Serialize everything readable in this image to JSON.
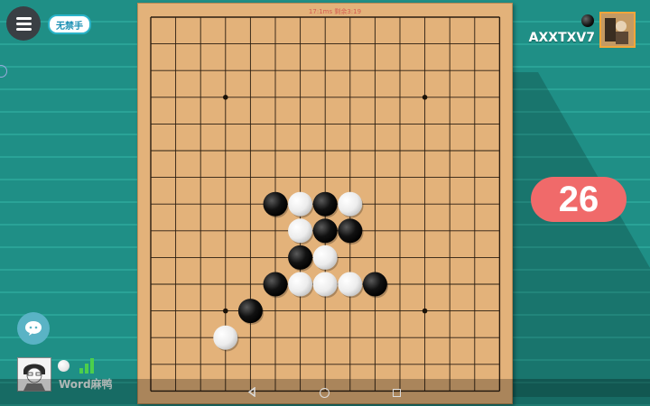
{
  "header": {
    "menu_icon": "hamburger-menu-icon",
    "rule_badge": "无禁手",
    "board_timer": "17:1ms  剩余3:19"
  },
  "opponent": {
    "name": "AXXTXV7",
    "stone_color": "black"
  },
  "move_count": "26",
  "player": {
    "name": "Word麻鸭",
    "stone_color": "white",
    "signal_bars": 3
  },
  "board": {
    "size": 15,
    "star_points": [
      [
        3,
        3
      ],
      [
        11,
        3
      ],
      [
        3,
        11
      ],
      [
        11,
        11
      ]
    ],
    "stones": [
      {
        "col": 5,
        "row": 7,
        "color": "black"
      },
      {
        "col": 6,
        "row": 7,
        "color": "white"
      },
      {
        "col": 7,
        "row": 7,
        "color": "black"
      },
      {
        "col": 8,
        "row": 7,
        "color": "white"
      },
      {
        "col": 6,
        "row": 8,
        "color": "white"
      },
      {
        "col": 7,
        "row": 8,
        "color": "black"
      },
      {
        "col": 8,
        "row": 8,
        "color": "black"
      },
      {
        "col": 6,
        "row": 9,
        "color": "black"
      },
      {
        "col": 7,
        "row": 9,
        "color": "white"
      },
      {
        "col": 5,
        "row": 10,
        "color": "black"
      },
      {
        "col": 6,
        "row": 10,
        "color": "white"
      },
      {
        "col": 7,
        "row": 10,
        "color": "white"
      },
      {
        "col": 8,
        "row": 10,
        "color": "white"
      },
      {
        "col": 9,
        "row": 10,
        "color": "black"
      },
      {
        "col": 4,
        "row": 11,
        "color": "black"
      },
      {
        "col": 3,
        "row": 12,
        "color": "white"
      }
    ]
  },
  "colors": {
    "accent_counter": "#f06a6a",
    "background": "#1f8f86",
    "board": "#e3b27a"
  }
}
